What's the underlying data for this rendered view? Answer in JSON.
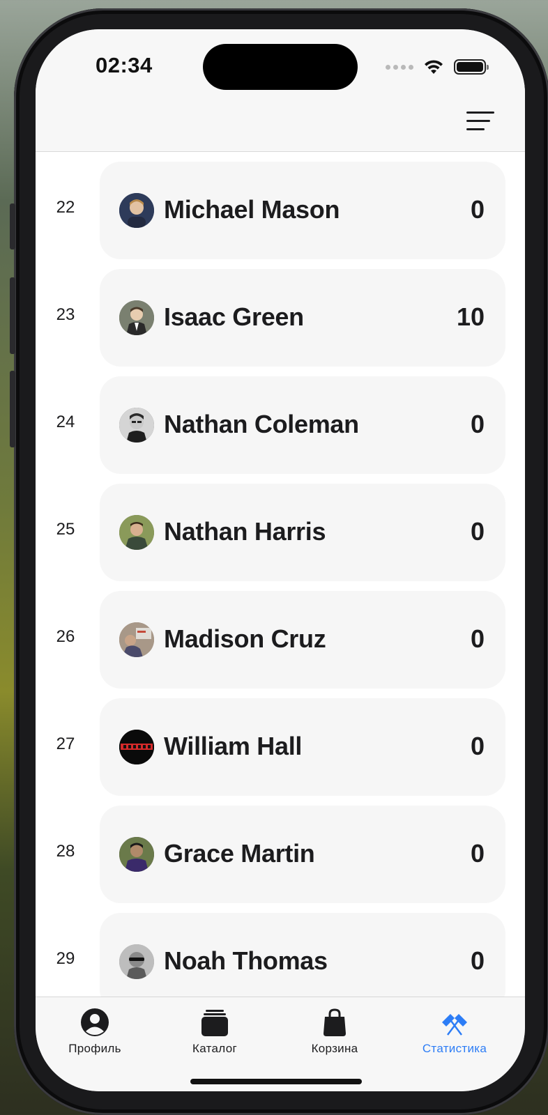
{
  "status_bar": {
    "time": "02:34"
  },
  "header": {
    "menu_icon": "hamburger-menu-icon"
  },
  "leaderboard": [
    {
      "rank": "22",
      "name": "Michael Mason",
      "score": "0",
      "avatar_color": "#3b4a6b"
    },
    {
      "rank": "23",
      "name": "Isaac Green",
      "score": "10",
      "avatar_color": "#6b6b5e"
    },
    {
      "rank": "24",
      "name": "Nathan Coleman",
      "score": "0",
      "avatar_color": "#4a4a4a"
    },
    {
      "rank": "25",
      "name": "Nathan Harris",
      "score": "0",
      "avatar_color": "#5d6a4a"
    },
    {
      "rank": "26",
      "name": "Madison Cruz",
      "score": "0",
      "avatar_color": "#8a7a6a"
    },
    {
      "rank": "27",
      "name": "William Hall",
      "score": "0",
      "avatar_color": "#111111"
    },
    {
      "rank": "28",
      "name": "Grace Martin",
      "score": "0",
      "avatar_color": "#4a3b5e"
    },
    {
      "rank": "29",
      "name": "Noah Thomas",
      "score": "0",
      "avatar_color": "#9a9a9a"
    }
  ],
  "tabbar": {
    "tabs": [
      {
        "label": "Профиль",
        "icon": "person-circle-icon"
      },
      {
        "label": "Каталог",
        "icon": "catalog-stack-icon"
      },
      {
        "label": "Корзина",
        "icon": "shopping-bag-icon"
      },
      {
        "label": "Статистика",
        "icon": "flags-icon",
        "active": true
      }
    ],
    "active_color": "#2d7df6"
  }
}
